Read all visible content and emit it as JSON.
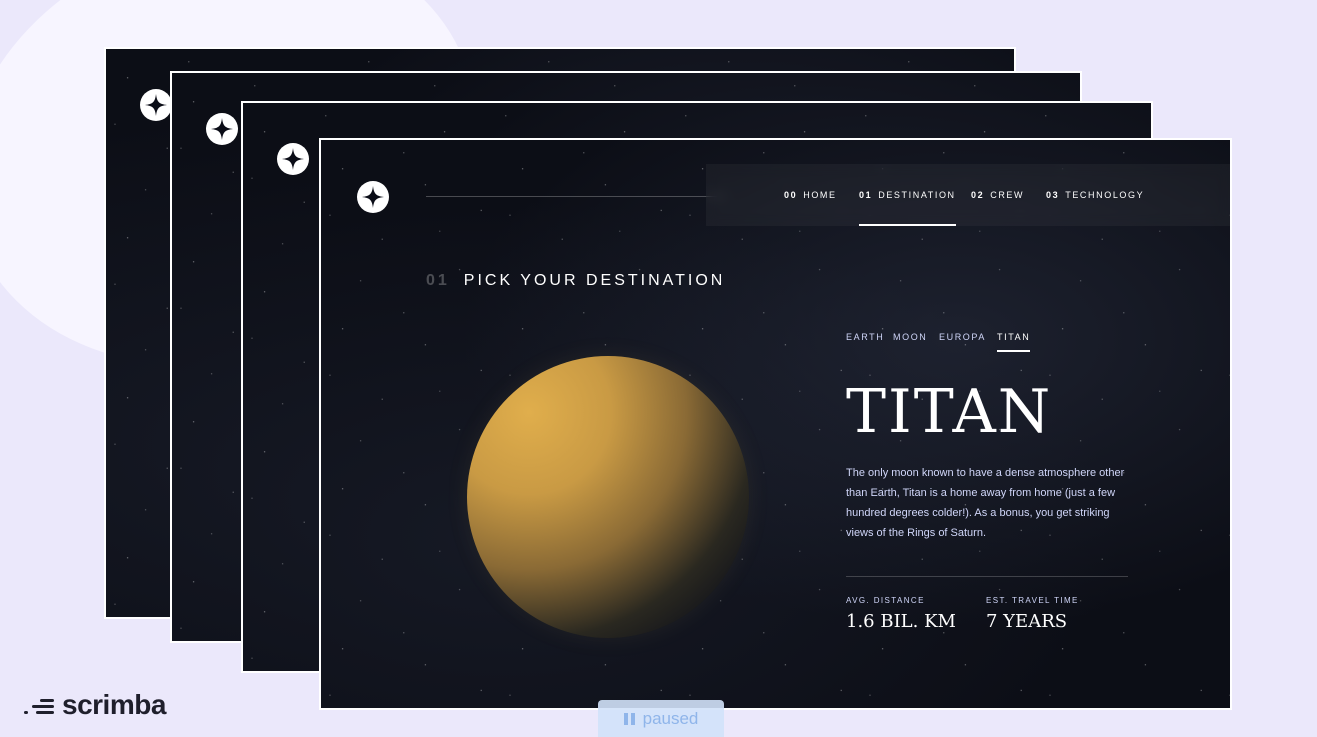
{
  "brand": {
    "name": "scrimba"
  },
  "playback": {
    "status": "paused"
  },
  "site": {
    "nav": [
      {
        "num": "00",
        "label": "HOME"
      },
      {
        "num": "01",
        "label": "DESTINATION",
        "active": true
      },
      {
        "num": "02",
        "label": "CREW"
      },
      {
        "num": "03",
        "label": "TECHNOLOGY"
      }
    ],
    "eyebrow": {
      "num": "01",
      "label": "PICK YOUR DESTINATION"
    },
    "tabs": [
      "EARTH",
      "MOON",
      "EUROPA",
      "TITAN"
    ],
    "active_tab": "TITAN",
    "planet": {
      "name": "TITAN",
      "description": "The only moon known to have a dense atmosphere other than Earth, Titan is a home away from home (just a few hundred degrees colder!). As a bonus, you get striking views of the Rings of Saturn.",
      "stats": [
        {
          "label": "AVG. DISTANCE",
          "value": "1.6 BIL. KM"
        },
        {
          "label": "EST. TRAVEL TIME",
          "value": "7 YEARS"
        }
      ]
    }
  },
  "colors": {
    "background": "#ebe8fb",
    "space": "#0c0e16",
    "text_light": "#d0d6f9",
    "paused_text": "#8fb5ea"
  },
  "icons": [
    "star-logo-icon",
    "pause-icon",
    "scrimba-logo-icon"
  ]
}
